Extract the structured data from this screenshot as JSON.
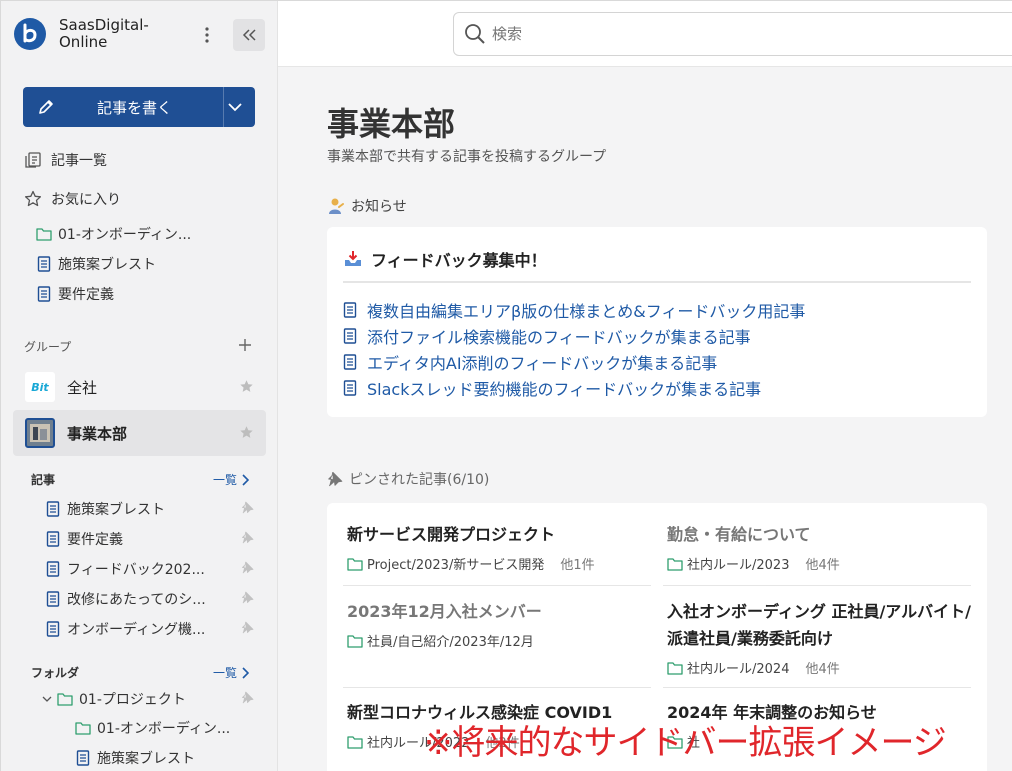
{
  "brand": {
    "name": "SaasDigital-Online"
  },
  "sidebar": {
    "write_label": "記事を書く",
    "nav": [
      {
        "label": "記事一覧",
        "icon": "articles-icon"
      },
      {
        "label": "お気に入り",
        "icon": "star-outline-icon"
      }
    ],
    "favorites": [
      {
        "label": "01-オンボーディン...",
        "icon": "folder-icon"
      },
      {
        "label": "施策案ブレスト",
        "icon": "document-icon"
      },
      {
        "label": "要件定義",
        "icon": "document-icon"
      }
    ],
    "groups_label": "グループ",
    "groups": [
      {
        "label": "全社",
        "logo_text": "Bit",
        "active": false
      },
      {
        "label": "事業本部",
        "active": true
      }
    ],
    "articles_label": "記事",
    "articles_more": "一覧",
    "articles": [
      {
        "label": "施策案ブレスト"
      },
      {
        "label": "要件定義"
      },
      {
        "label": "フィードバック202..."
      },
      {
        "label": "改修にあたってのシ..."
      },
      {
        "label": "オンボーディング機..."
      }
    ],
    "folders_label": "フォルダ",
    "folders_more": "一覧",
    "folders": [
      {
        "label": "01-プロジェクト",
        "icon": "folder-icon"
      },
      {
        "label": "01-オンボーディン...",
        "icon": "folder-icon"
      },
      {
        "label": "施策案ブレスト",
        "icon": "document-icon"
      }
    ]
  },
  "search": {
    "placeholder": "検索"
  },
  "page": {
    "title": "事業本部",
    "description": "事業本部で共有する記事を投稿するグループ",
    "notice_label": "お知らせ",
    "notice": {
      "title": "フィードバック募集中！",
      "links": [
        "複数自由編集エリアβ版の仕様まとめ&フィードバック用記事",
        "添付ファイル検索機能のフィードバックが集まる記事",
        "エディタ内AI添削のフィードバックが集まる記事",
        "Slackスレッド要約機能のフィードバックが集まる記事"
      ]
    },
    "pinned_label": "ピンされた記事(6/10)",
    "pinned": [
      {
        "title": "新サービス開発プロジェクト",
        "path": "Project/2023/新サービス開発",
        "count": "他1件",
        "dim": false
      },
      {
        "title": "勤怠・有給について",
        "path": "社内ルール/2023",
        "count": "他4件",
        "dim": true
      },
      {
        "title": "2023年12月入社メンバー",
        "path": "社員/自己紹介/2023年/12月",
        "count": "",
        "dim": true
      },
      {
        "title": "入社オンボーディング 正社員/アルバイト/派遣社員/業務委託向け",
        "path": "社内ルール/2024",
        "count": "他4件",
        "dim": false
      },
      {
        "title": "新型コロナウィルス感染症 COVID1",
        "path": "社内ルール/2022",
        "count": "他2件",
        "dim": false
      },
      {
        "title": "2024年 年末調整のお知らせ",
        "path": "社",
        "count": "",
        "dim": false
      }
    ]
  },
  "overlay_caption": "※将来的なサイドバー拡張イメージ",
  "colors": {
    "primary": "#1f4f94",
    "link": "#1f5aa6",
    "folder": "#2f9e6e",
    "overlay": "#e0262b"
  }
}
